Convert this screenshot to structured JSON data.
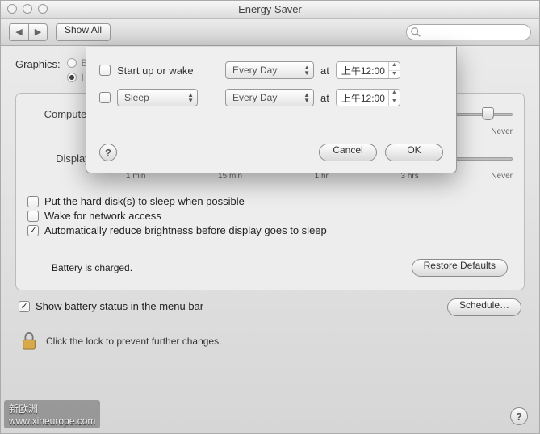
{
  "window": {
    "title": "Energy Saver"
  },
  "toolbar": {
    "show_all": "Show All",
    "search_placeholder": ""
  },
  "graphics": {
    "label": "Graphics:",
    "options": [
      "Better battery life",
      "Higher performance"
    ]
  },
  "panel": {
    "computer_sleep_label": "Computer sleep:",
    "display_sleep_label": "Display sleep:",
    "ticks": [
      "1 min",
      "15 min",
      "1 hr",
      "3 hrs",
      "Never"
    ],
    "check1": "Put the hard disk(s) to sleep when possible",
    "check2": "Wake for network access",
    "check3": "Automatically reduce brightness before display goes to sleep",
    "status": "Battery is charged.",
    "restore": "Restore Defaults"
  },
  "outer": {
    "show_battery": "Show battery status in the menu bar",
    "schedule": "Schedule…"
  },
  "lock": {
    "text": "Click the lock to prevent further changes."
  },
  "sheet": {
    "row1_label": "Start up or wake",
    "row2_label": "Sleep",
    "freq": "Every Day",
    "at": "at",
    "time": "上午12:00",
    "cancel": "Cancel",
    "ok": "OK"
  },
  "watermark": {
    "line1": "新欧洲",
    "line2": "www.xineurope.com"
  }
}
